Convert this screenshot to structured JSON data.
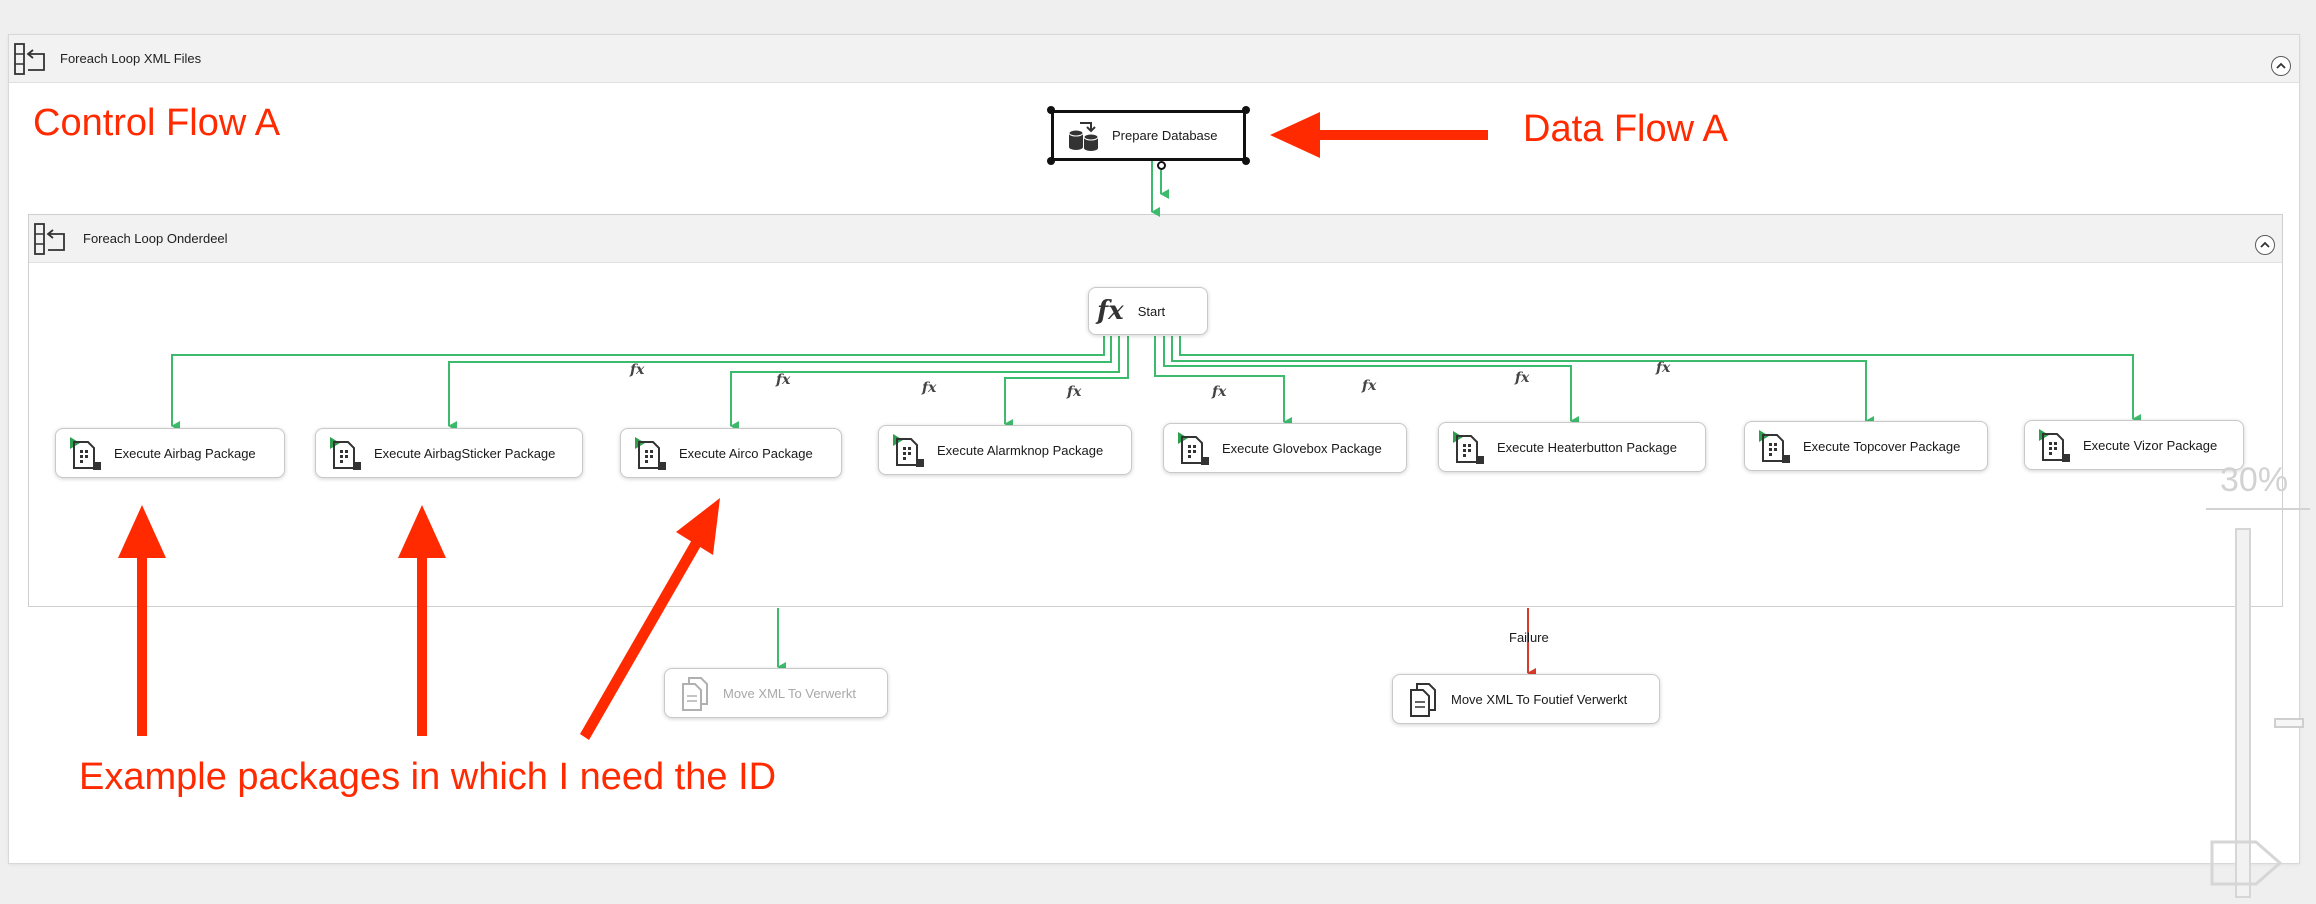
{
  "outer_container": {
    "title": "Foreach Loop XML Files"
  },
  "inner_container": {
    "title": "Foreach Loop Onderdeel"
  },
  "tasks": {
    "prepare_db": "Prepare Database",
    "start": "Start",
    "move_verwerkt": "Move XML To Verwerkt",
    "move_foutief": "Move XML To Foutief Verwerkt"
  },
  "packages": [
    "Execute Airbag Package",
    "Execute AirbagSticker Package",
    "Execute Airco Package",
    "Execute Alarmknop Package",
    "Execute Glovebox Package",
    "Execute Heaterbutton Package",
    "Execute Topcover Package",
    "Execute Vizor Package"
  ],
  "expression_marker": "fx",
  "failure_label": "Failure",
  "zoom": {
    "level": "30%"
  },
  "annotations": {
    "control_flow": "Control Flow A",
    "data_flow": "Data Flow A",
    "example": "Example packages in which I need the ID"
  },
  "colors": {
    "success": "#3dbb6c",
    "failure": "#d83a2a",
    "annotation": "#ff2a00"
  }
}
